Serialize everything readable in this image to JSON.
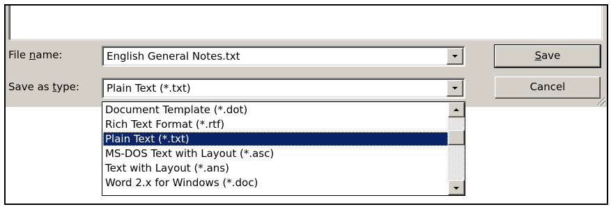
{
  "colors": {
    "dialog_face": "#d4d0c8",
    "selection": "#0a246a",
    "window_bg": "#ffffff"
  },
  "file_name": {
    "label_before": "File ",
    "label_accel": "n",
    "label_after": "ame:",
    "value": "English General Notes.txt"
  },
  "save_as_type": {
    "label_before": "Save as ",
    "label_accel": "t",
    "label_after": "ype:",
    "value": "Plain Text (*.txt)"
  },
  "buttons": {
    "save_accel": "S",
    "save_rest": "ave",
    "cancel": "Cancel"
  },
  "dropdown": {
    "items": [
      "Document Template (*.dot)",
      "Rich Text Format (*.rtf)",
      "Plain Text (*.txt)",
      "MS-DOS Text with Layout (*.asc)",
      "Text with Layout (*.ans)",
      "Word 2.x for Windows (*.doc)"
    ],
    "selected_index": 2
  },
  "icons": {
    "combo_arrow": "chevron-down-icon",
    "scroll_up": "scroll-up-arrow-icon",
    "scroll_down": "scroll-down-arrow-icon",
    "resize": "resize-grip-icon"
  }
}
